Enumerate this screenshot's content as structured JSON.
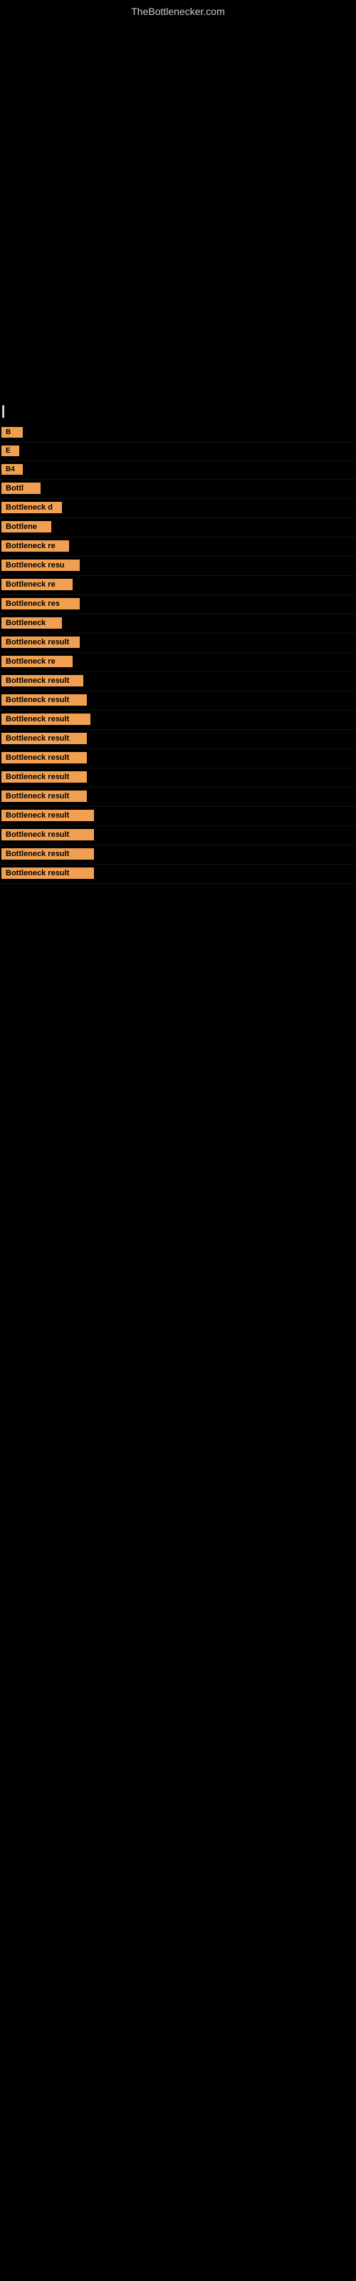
{
  "site": {
    "title": "TheBottlenecker.com"
  },
  "results": [
    {
      "id": 1,
      "label": "B",
      "rowClass": "row-b1"
    },
    {
      "id": 2,
      "label": "E",
      "rowClass": "row-b2"
    },
    {
      "id": 3,
      "label": "B4",
      "rowClass": "row-b3"
    },
    {
      "id": 4,
      "label": "Bottl",
      "rowClass": "row-b4"
    },
    {
      "id": 5,
      "label": "Bottleneck d",
      "rowClass": "row-b5"
    },
    {
      "id": 6,
      "label": "Bottlene",
      "rowClass": "row-b6"
    },
    {
      "id": 7,
      "label": "Bottleneck re",
      "rowClass": "row-b7"
    },
    {
      "id": 8,
      "label": "Bottleneck resu",
      "rowClass": "row-b8"
    },
    {
      "id": 9,
      "label": "Bottleneck re",
      "rowClass": "row-b9"
    },
    {
      "id": 10,
      "label": "Bottleneck res",
      "rowClass": "row-b10"
    },
    {
      "id": 11,
      "label": "Bottleneck",
      "rowClass": "row-b11"
    },
    {
      "id": 12,
      "label": "Bottleneck result",
      "rowClass": "row-b12"
    },
    {
      "id": 13,
      "label": "Bottleneck re",
      "rowClass": "row-b13"
    },
    {
      "id": 14,
      "label": "Bottleneck result",
      "rowClass": "row-b14"
    },
    {
      "id": 15,
      "label": "Bottleneck result",
      "rowClass": "row-b15"
    },
    {
      "id": 16,
      "label": "Bottleneck result",
      "rowClass": "row-b16"
    },
    {
      "id": 17,
      "label": "Bottleneck result",
      "rowClass": "row-b17"
    },
    {
      "id": 18,
      "label": "Bottleneck result",
      "rowClass": "row-b18"
    },
    {
      "id": 19,
      "label": "Bottleneck result",
      "rowClass": "row-b19"
    },
    {
      "id": 20,
      "label": "Bottleneck result",
      "rowClass": "row-b20"
    },
    {
      "id": 21,
      "label": "Bottleneck result",
      "rowClass": "row-b21"
    },
    {
      "id": 22,
      "label": "Bottleneck result",
      "rowClass": "row-b22"
    },
    {
      "id": 23,
      "label": "Bottleneck result",
      "rowClass": "row-b23"
    },
    {
      "id": 24,
      "label": "Bottleneck result",
      "rowClass": "row-b24"
    }
  ]
}
